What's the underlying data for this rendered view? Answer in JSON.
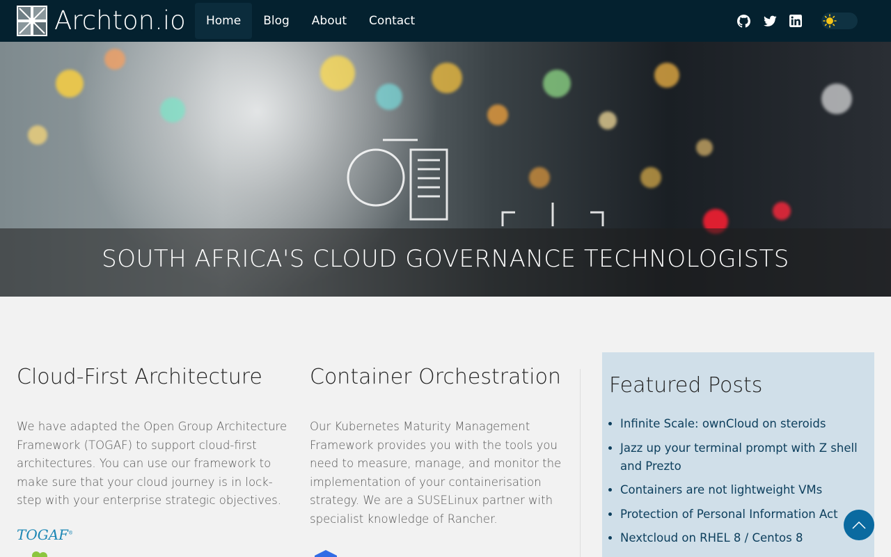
{
  "brand": {
    "name": "Archton.io"
  },
  "nav": {
    "items": [
      {
        "label": "Home",
        "active": true
      },
      {
        "label": "Blog",
        "active": false
      },
      {
        "label": "About",
        "active": false
      },
      {
        "label": "Contact",
        "active": false
      }
    ]
  },
  "social": {
    "icons": [
      "github-icon",
      "twitter-icon",
      "linkedin-icon"
    ]
  },
  "theme_toggle": {
    "icon": "sun-icon",
    "state": "light"
  },
  "hero": {
    "title": "SOUTH AFRICA'S CLOUD GOVERNANCE TECHNOLOGISTS"
  },
  "columns": [
    {
      "heading": "Cloud-First Architecture",
      "body": "We have adapted the Open Group Architecture Framework (TOGAF) to support cloud-first architectures. You can use our framework to make sure that your cloud journey is in lock-step with your enterprise strategic objectives.",
      "logo_text": "TOGAF"
    },
    {
      "heading": "Container Orchestration",
      "body": "Our Kubernetes Maturity Management Framework provides you with the tools you need to measure, manage, and monitor the implementation of your containerisation strategy. We are a SUSELinux partner with specialist knowledge of Rancher."
    }
  ],
  "featured": {
    "title": "Featured Posts",
    "posts": [
      "Infinite Scale: ownCloud on steroids",
      "Jazz up your terminal prompt with Z shell and Prezto",
      "Containers are not lightweight VMs",
      "Protection of Personal Information Act",
      "Nextcloud on RHEL 8 / Centos 8"
    ]
  },
  "colors": {
    "navbar": "#04212f",
    "featured_bg": "#d0dfe9",
    "link": "#0c3e5c",
    "to_top": "#0a6aa0",
    "sun": "#f5c518"
  }
}
